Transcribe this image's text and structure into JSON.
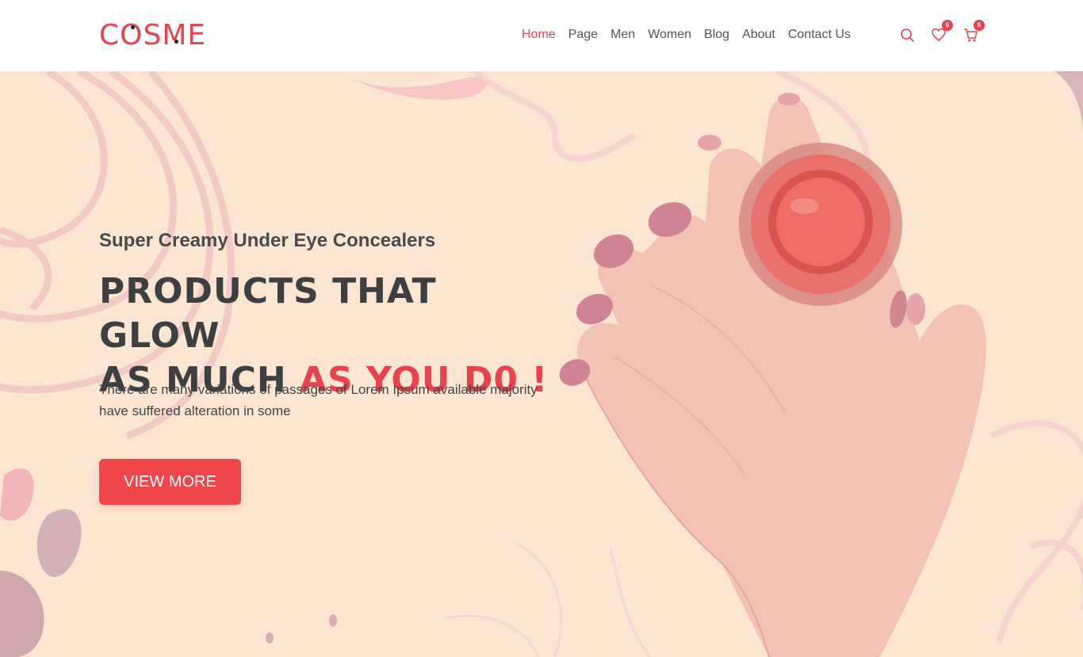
{
  "brand": {
    "name": "COSME",
    "color": "#e8434c"
  },
  "nav": {
    "items": [
      {
        "label": "Home",
        "active": true
      },
      {
        "label": "Page",
        "active": false
      },
      {
        "label": "Men",
        "active": false
      },
      {
        "label": "Women",
        "active": false
      },
      {
        "label": "Blog",
        "active": false
      },
      {
        "label": "About",
        "active": false
      },
      {
        "label": "Contact Us",
        "active": false
      }
    ]
  },
  "header_icons": {
    "search": {
      "icon": "search-icon"
    },
    "wishlist": {
      "icon": "heart-icon",
      "count": "6"
    },
    "cart": {
      "icon": "cart-icon",
      "count": "6"
    }
  },
  "hero": {
    "subtitle": "Super Creamy Under Eye Concealers",
    "headline_line1": "PRODUCTS THAT GLOW",
    "headline_line2_prefix": "AS MUCH ",
    "headline_line2_accent": "AS YOU D0 !",
    "description": "There are many variations of passages of Lorem Ipsum available majority have suffered alteration in some",
    "cta_label": "VIEW MORE",
    "background_color": "#fde6d1",
    "accent_color": "#e8434c"
  }
}
